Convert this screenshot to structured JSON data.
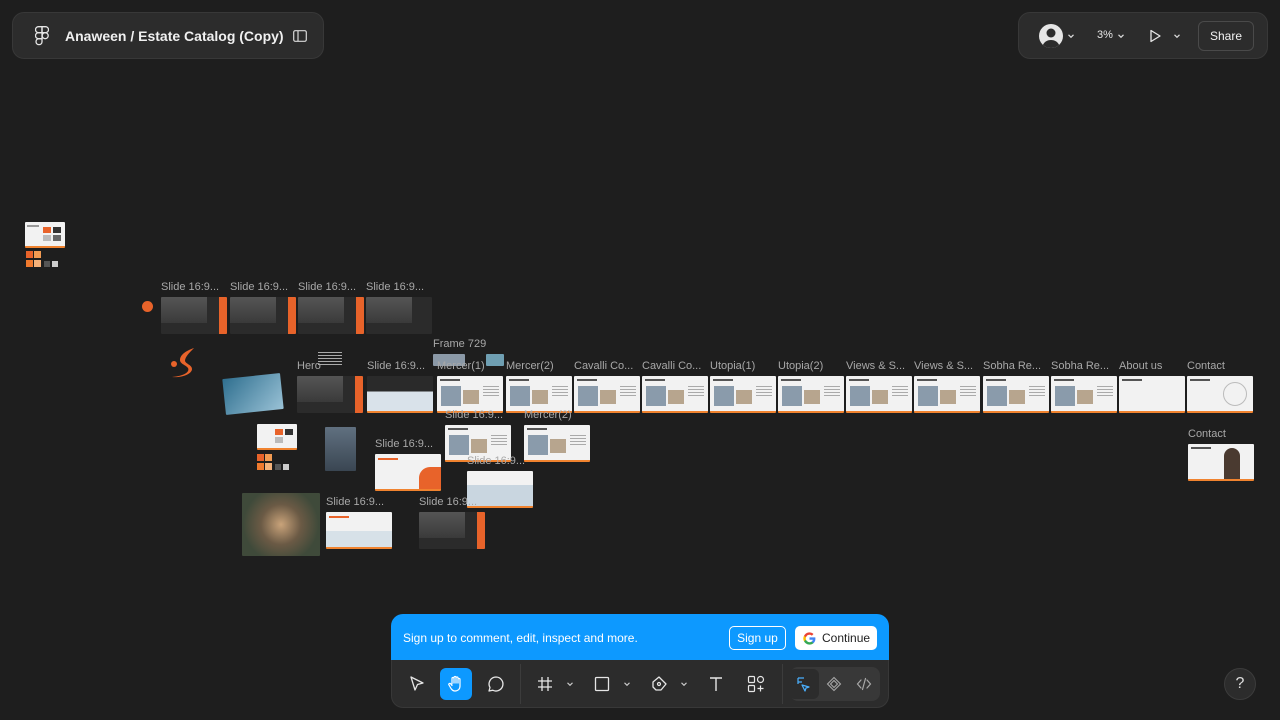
{
  "file": {
    "title": "Anaween / Estate Catalog (Copy)"
  },
  "header_right": {
    "zoom": "3%",
    "share_label": "Share"
  },
  "canvas": {
    "labels": {
      "slide1": "Slide 16:9...",
      "slide2": "Slide 16:9...",
      "slide3": "Slide 16:9...",
      "slide4": "Slide 16:9...",
      "frame729": "Frame 729",
      "hero": "Hero",
      "slide5": "Slide 16:9...",
      "mercer1": "Mercer(1)",
      "mercer2": "Mercer(2)",
      "cavalli1": "Cavalli Co...",
      "cavalli2": "Cavalli Co...",
      "utopia1": "Utopia(1)",
      "utopia2": "Utopia(2)",
      "views1": "Views & S...",
      "views2": "Views & S...",
      "sobha1": "Sobha Re...",
      "sobha2": "Sobha Re...",
      "about": "About us",
      "contact1": "Contact",
      "contact2": "Contact",
      "slide6": "Slide 16:9...",
      "mercer3": "Mercer(2)",
      "slide7": "Slide 16:9...",
      "slide8": "Slide 16:9...",
      "slide9": "Slide 16:9...",
      "slide10": "Slide 16:9..."
    }
  },
  "signup": {
    "message": "Sign up to comment, edit, inspect and more.",
    "signup_label": "Sign up",
    "continue_label": "Continue"
  },
  "help": {
    "label": "?"
  },
  "colors": {
    "accent": "#0d99ff",
    "brand_orange": "#e8632a",
    "canvas": "#1e1e1e",
    "panel": "#2c2c2c"
  }
}
